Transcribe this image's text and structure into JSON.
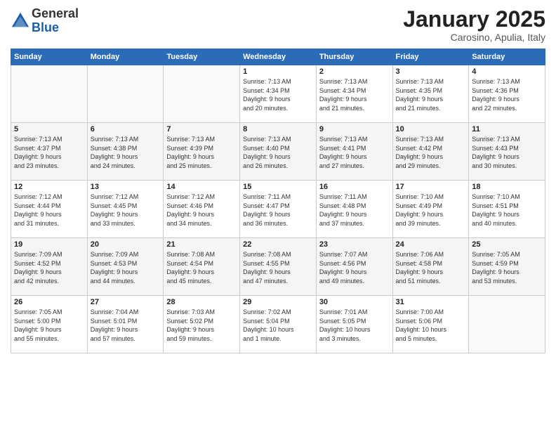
{
  "logo": {
    "general": "General",
    "blue": "Blue"
  },
  "header": {
    "month": "January 2025",
    "location": "Carosino, Apulia, Italy"
  },
  "weekdays": [
    "Sunday",
    "Monday",
    "Tuesday",
    "Wednesday",
    "Thursday",
    "Friday",
    "Saturday"
  ],
  "weeks": [
    [
      {
        "day": "",
        "info": ""
      },
      {
        "day": "",
        "info": ""
      },
      {
        "day": "",
        "info": ""
      },
      {
        "day": "1",
        "info": "Sunrise: 7:13 AM\nSunset: 4:34 PM\nDaylight: 9 hours\nand 20 minutes."
      },
      {
        "day": "2",
        "info": "Sunrise: 7:13 AM\nSunset: 4:34 PM\nDaylight: 9 hours\nand 21 minutes."
      },
      {
        "day": "3",
        "info": "Sunrise: 7:13 AM\nSunset: 4:35 PM\nDaylight: 9 hours\nand 21 minutes."
      },
      {
        "day": "4",
        "info": "Sunrise: 7:13 AM\nSunset: 4:36 PM\nDaylight: 9 hours\nand 22 minutes."
      }
    ],
    [
      {
        "day": "5",
        "info": "Sunrise: 7:13 AM\nSunset: 4:37 PM\nDaylight: 9 hours\nand 23 minutes."
      },
      {
        "day": "6",
        "info": "Sunrise: 7:13 AM\nSunset: 4:38 PM\nDaylight: 9 hours\nand 24 minutes."
      },
      {
        "day": "7",
        "info": "Sunrise: 7:13 AM\nSunset: 4:39 PM\nDaylight: 9 hours\nand 25 minutes."
      },
      {
        "day": "8",
        "info": "Sunrise: 7:13 AM\nSunset: 4:40 PM\nDaylight: 9 hours\nand 26 minutes."
      },
      {
        "day": "9",
        "info": "Sunrise: 7:13 AM\nSunset: 4:41 PM\nDaylight: 9 hours\nand 27 minutes."
      },
      {
        "day": "10",
        "info": "Sunrise: 7:13 AM\nSunset: 4:42 PM\nDaylight: 9 hours\nand 29 minutes."
      },
      {
        "day": "11",
        "info": "Sunrise: 7:13 AM\nSunset: 4:43 PM\nDaylight: 9 hours\nand 30 minutes."
      }
    ],
    [
      {
        "day": "12",
        "info": "Sunrise: 7:12 AM\nSunset: 4:44 PM\nDaylight: 9 hours\nand 31 minutes."
      },
      {
        "day": "13",
        "info": "Sunrise: 7:12 AM\nSunset: 4:45 PM\nDaylight: 9 hours\nand 33 minutes."
      },
      {
        "day": "14",
        "info": "Sunrise: 7:12 AM\nSunset: 4:46 PM\nDaylight: 9 hours\nand 34 minutes."
      },
      {
        "day": "15",
        "info": "Sunrise: 7:11 AM\nSunset: 4:47 PM\nDaylight: 9 hours\nand 36 minutes."
      },
      {
        "day": "16",
        "info": "Sunrise: 7:11 AM\nSunset: 4:48 PM\nDaylight: 9 hours\nand 37 minutes."
      },
      {
        "day": "17",
        "info": "Sunrise: 7:10 AM\nSunset: 4:49 PM\nDaylight: 9 hours\nand 39 minutes."
      },
      {
        "day": "18",
        "info": "Sunrise: 7:10 AM\nSunset: 4:51 PM\nDaylight: 9 hours\nand 40 minutes."
      }
    ],
    [
      {
        "day": "19",
        "info": "Sunrise: 7:09 AM\nSunset: 4:52 PM\nDaylight: 9 hours\nand 42 minutes."
      },
      {
        "day": "20",
        "info": "Sunrise: 7:09 AM\nSunset: 4:53 PM\nDaylight: 9 hours\nand 44 minutes."
      },
      {
        "day": "21",
        "info": "Sunrise: 7:08 AM\nSunset: 4:54 PM\nDaylight: 9 hours\nand 45 minutes."
      },
      {
        "day": "22",
        "info": "Sunrise: 7:08 AM\nSunset: 4:55 PM\nDaylight: 9 hours\nand 47 minutes."
      },
      {
        "day": "23",
        "info": "Sunrise: 7:07 AM\nSunset: 4:56 PM\nDaylight: 9 hours\nand 49 minutes."
      },
      {
        "day": "24",
        "info": "Sunrise: 7:06 AM\nSunset: 4:58 PM\nDaylight: 9 hours\nand 51 minutes."
      },
      {
        "day": "25",
        "info": "Sunrise: 7:05 AM\nSunset: 4:59 PM\nDaylight: 9 hours\nand 53 minutes."
      }
    ],
    [
      {
        "day": "26",
        "info": "Sunrise: 7:05 AM\nSunset: 5:00 PM\nDaylight: 9 hours\nand 55 minutes."
      },
      {
        "day": "27",
        "info": "Sunrise: 7:04 AM\nSunset: 5:01 PM\nDaylight: 9 hours\nand 57 minutes."
      },
      {
        "day": "28",
        "info": "Sunrise: 7:03 AM\nSunset: 5:02 PM\nDaylight: 9 hours\nand 59 minutes."
      },
      {
        "day": "29",
        "info": "Sunrise: 7:02 AM\nSunset: 5:04 PM\nDaylight: 10 hours\nand 1 minute."
      },
      {
        "day": "30",
        "info": "Sunrise: 7:01 AM\nSunset: 5:05 PM\nDaylight: 10 hours\nand 3 minutes."
      },
      {
        "day": "31",
        "info": "Sunrise: 7:00 AM\nSunset: 5:06 PM\nDaylight: 10 hours\nand 5 minutes."
      },
      {
        "day": "",
        "info": ""
      }
    ]
  ]
}
